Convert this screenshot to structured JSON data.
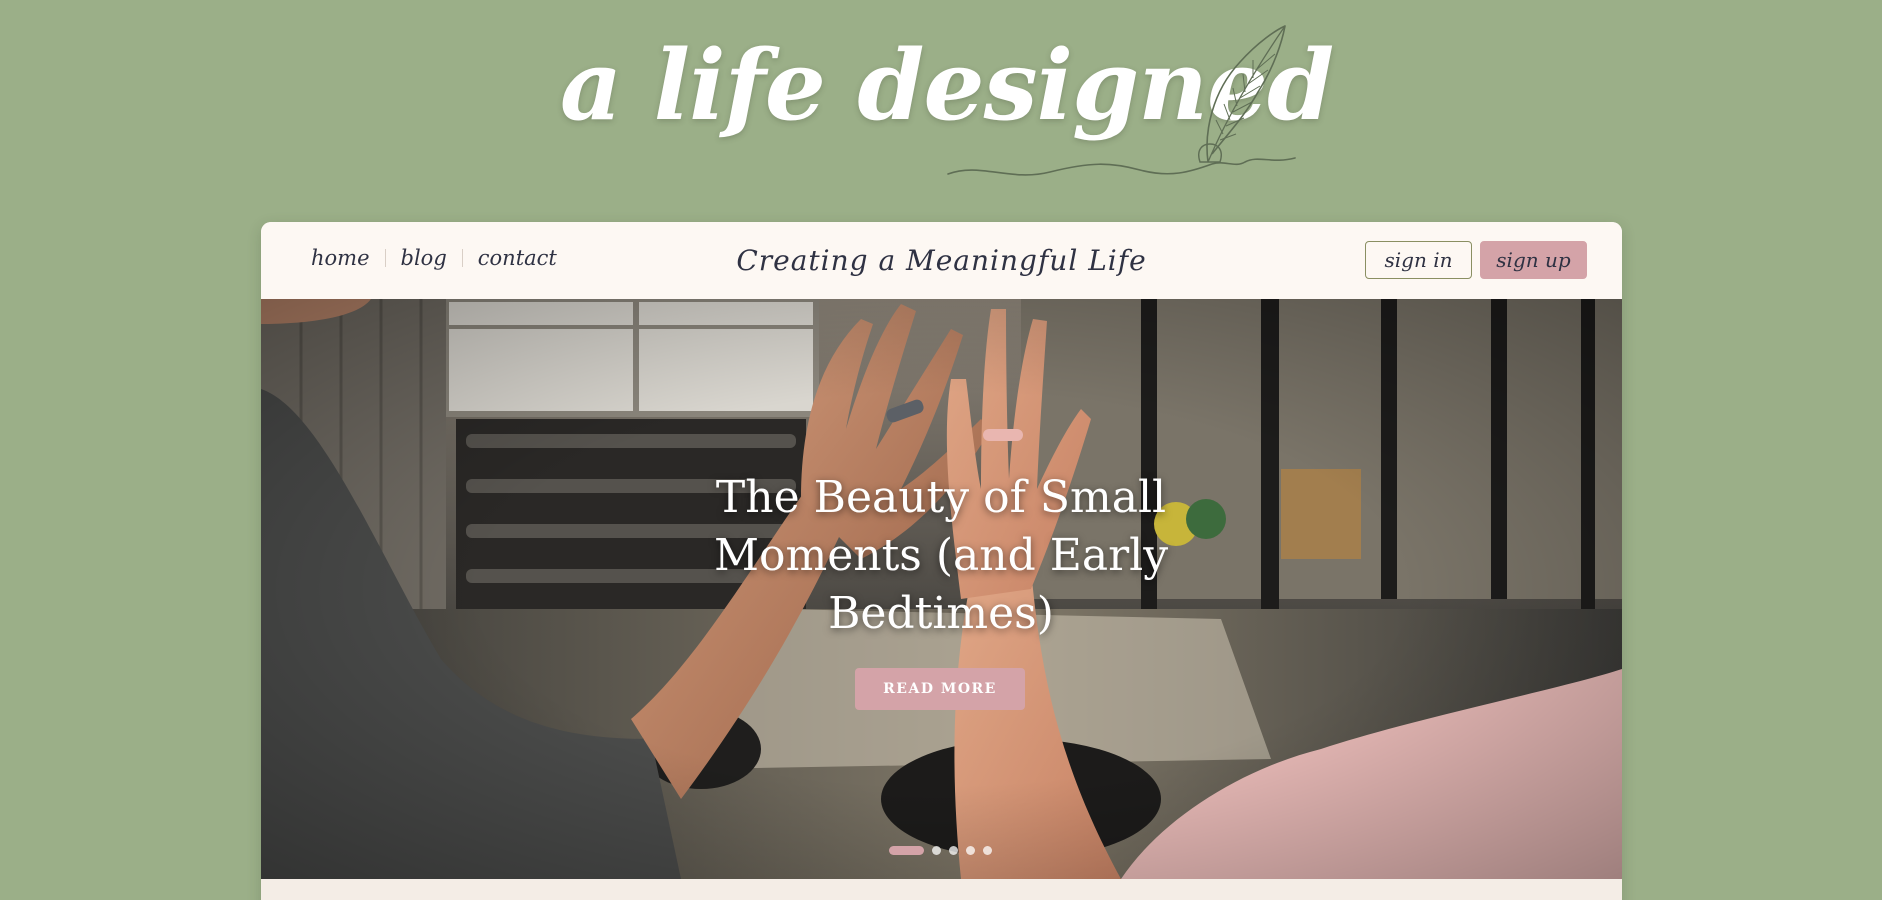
{
  "brand": {
    "logo_text": "a life designed",
    "icon": "quill-pen-icon"
  },
  "nav": {
    "links": [
      {
        "label": "home"
      },
      {
        "label": "blog"
      },
      {
        "label": "contact"
      }
    ],
    "tagline": "Creating a Meaningful Life",
    "signin_label": "sign in",
    "signup_label": "sign up"
  },
  "hero": {
    "title": "The Beauty of Small Moments (and Early Bedtimes)",
    "cta_label": "READ MORE",
    "slides_total": 5,
    "active_slide": 1
  },
  "colors": {
    "background": "#9baf88",
    "card": "#fdf8f3",
    "accent_pink": "#d4a3a8",
    "text_dark": "#2f3243",
    "outline_olive": "#8a8f62"
  }
}
